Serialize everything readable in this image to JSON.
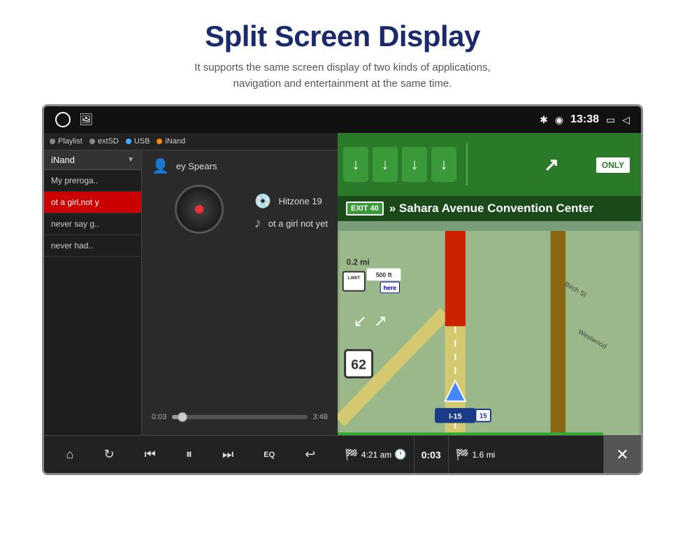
{
  "header": {
    "title": "Split Screen Display",
    "subtitle": "It supports the same screen display of two kinds of applications,\nnavigation and entertainment at the same time."
  },
  "status_bar": {
    "time": "13:38",
    "icons": [
      "bluetooth",
      "location",
      "battery",
      "back"
    ]
  },
  "music_player": {
    "source_options": [
      "Playlist",
      "extSD",
      "USB",
      "iNand"
    ],
    "active_source": "iNand",
    "dropdown_label": "iNand",
    "playlist": [
      {
        "label": "My preroga..",
        "active": false
      },
      {
        "label": "ot a girl,not y",
        "active": true
      },
      {
        "label": "never say g..",
        "active": false
      },
      {
        "label": "never had..",
        "active": false
      }
    ],
    "track_artist": "ey Spears",
    "track_album": "Hitzone 19",
    "track_title": "ot a girl not yet",
    "time_current": "0:03",
    "time_total": "3:48",
    "progress_percent": 4,
    "controls": [
      "home",
      "repeat",
      "prev",
      "pause",
      "next",
      "eq",
      "back"
    ]
  },
  "navigation": {
    "highway_sign": "I-15",
    "only_label": "ONLY",
    "exit_number": "EXIT 40",
    "exit_street": "» Sahara Avenue Convention Center",
    "distance_mi": "0.2 mi",
    "speed_limit": "62",
    "highway_badge": "I-15",
    "road_label_1": "Birch St",
    "road_label_2": "Westwood",
    "here_label": "here",
    "ft_label": "500 ft",
    "limit_label": "LIMIT",
    "nav_arrival": "4:21 am",
    "nav_elapsed": "0:03",
    "nav_dist": "1.6 mi",
    "close_label": "✕"
  }
}
